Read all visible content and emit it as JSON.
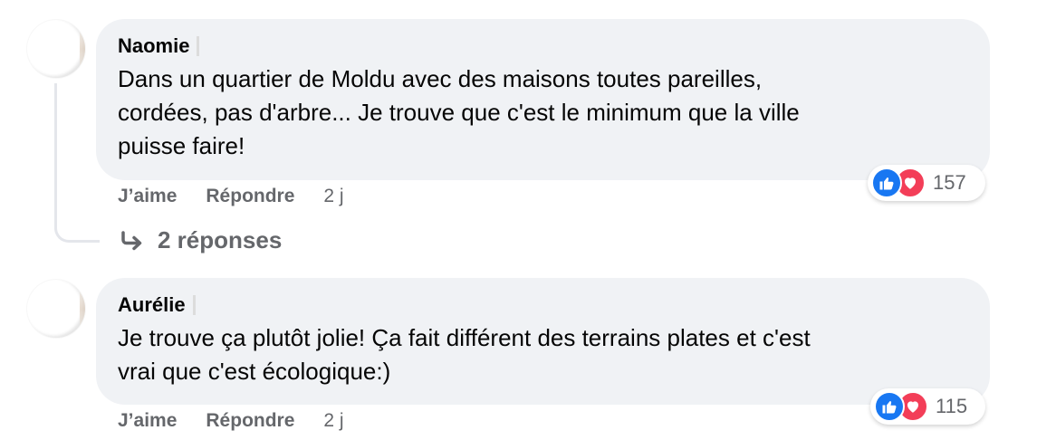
{
  "comments": [
    {
      "author": "Naomie",
      "text": "Dans un quartier de Moldu avec des maisons toutes pareilles,\ncordées, pas d'arbre... Je trouve que c'est le minimum que la ville\npuisse faire!",
      "like_label": "J’aime",
      "reply_label": "Répondre",
      "time": "2 j",
      "reaction_count": "157",
      "replies_label": "2 réponses"
    },
    {
      "author": "Aurélie",
      "text": "Je trouve ça plutôt jolie! Ça fait différent des terrains plates et c'est\nvrai que c'est écologique:)",
      "like_label": "J’aime",
      "reply_label": "Répondre",
      "time": "2 j",
      "reaction_count": "115"
    }
  ],
  "icons": {
    "like": "thumbs-up-icon",
    "love": "heart-icon",
    "replies": "reply-arrow-icon"
  },
  "colors": {
    "bubble": "#f0f2f5",
    "secondary_text": "#65676b",
    "like_blue": "#1877f2",
    "love_red": "#f33e58"
  }
}
